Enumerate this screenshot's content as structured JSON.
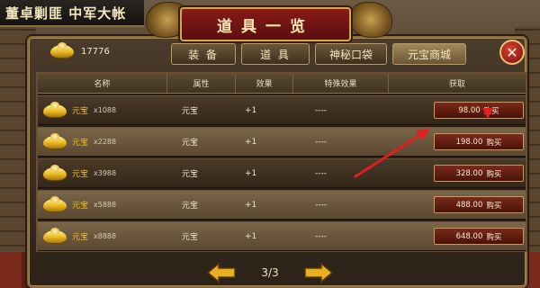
{
  "location": "董卓剿匪 中军大帐",
  "window": {
    "title": "道具一览"
  },
  "balance": {
    "amount": "17776",
    "icon": "gold-ingot-icon"
  },
  "tabs": [
    {
      "label": "装 备",
      "active": false
    },
    {
      "label": "道 具",
      "active": false
    },
    {
      "label": "神秘口袋",
      "active": false
    },
    {
      "label": "元宝商城",
      "active": true
    }
  ],
  "table": {
    "headers": [
      "名称",
      "属性",
      "效果",
      "特殊效果",
      "获取"
    ],
    "rows": [
      {
        "name": "元宝",
        "qty": "x1088",
        "attr": "元宝",
        "effect": "+1",
        "special": "----",
        "price": "98.00",
        "buy": "购买"
      },
      {
        "name": "元宝",
        "qty": "x2288",
        "attr": "元宝",
        "effect": "+1",
        "special": "----",
        "price": "198.00",
        "buy": "购买"
      },
      {
        "name": "元宝",
        "qty": "x3988",
        "attr": "元宝",
        "effect": "+1",
        "special": "----",
        "price": "328.00",
        "buy": "购买"
      },
      {
        "name": "元宝",
        "qty": "x5888",
        "attr": "元宝",
        "effect": "+1",
        "special": "----",
        "price": "488.00",
        "buy": "购买"
      },
      {
        "name": "元宝",
        "qty": "x8888",
        "attr": "元宝",
        "effect": "+1",
        "special": "----",
        "price": "648.00",
        "buy": "购买"
      }
    ]
  },
  "pager": {
    "indicator": "3/3"
  },
  "colors": {
    "accent": "#d0a850",
    "annotation": "#e02020",
    "item_name": "#f2c020"
  }
}
